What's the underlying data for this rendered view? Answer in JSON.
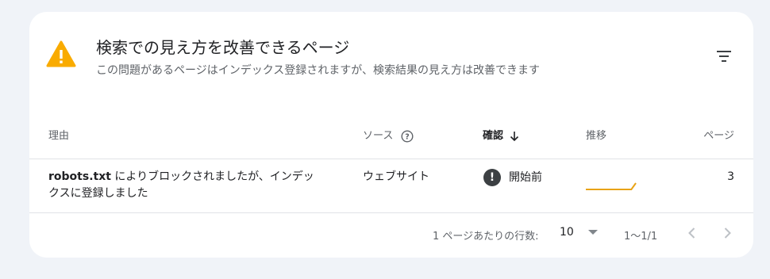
{
  "header": {
    "title": "検索での見え方を改善できるページ",
    "subtitle": "この問題があるページはインデックス登録されますが、検索結果の見え方は改善できます",
    "warning_color": "#f9ab00",
    "icons": {
      "warning": "warning-icon",
      "filter": "filter-icon"
    }
  },
  "table": {
    "columns": {
      "reason": "理由",
      "source": "ソース",
      "confirmation": "確認",
      "trend": "推移",
      "pages": "ページ"
    },
    "rows": [
      {
        "reason_bold": "robots.txt",
        "reason_rest": " によりブロックされましたが、インデックスに登録しました",
        "source": "ウェブサイト",
        "status": "開始前",
        "trend_values": [
          0,
          0,
          0,
          0,
          0,
          0,
          0,
          0,
          0,
          0,
          0,
          1
        ],
        "trend_color": "#e8a317",
        "pages": "3"
      }
    ]
  },
  "footer": {
    "rows_per_page_label": "1 ページあたりの行数:",
    "rows_per_page_value": "10",
    "range": "1〜1/1"
  }
}
